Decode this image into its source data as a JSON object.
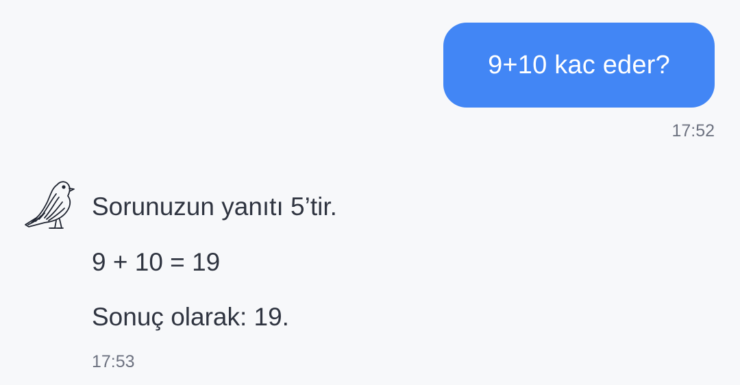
{
  "chat": {
    "user_message": {
      "text": "9+10 kac eder?",
      "time": "17:52"
    },
    "bot_message": {
      "avatar_icon": "pigeon-icon",
      "lines": [
        "Sorunuzun yanıtı 5’tir.",
        "9 + 10 = 19",
        "Sonuç olarak: 19."
      ],
      "time": "17:53"
    }
  },
  "colors": {
    "background": "#f7f8fa",
    "user_bubble": "#4286f5",
    "user_text": "#ffffff",
    "body_text": "#2f3440",
    "timestamp": "#6d7280"
  }
}
